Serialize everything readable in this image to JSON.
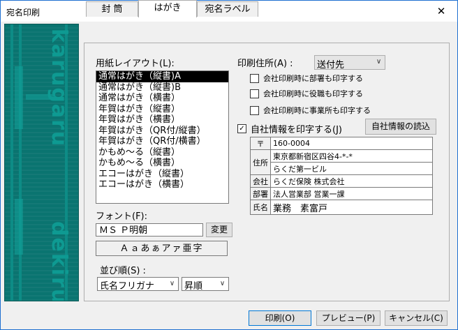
{
  "window": {
    "title": "宛名印刷",
    "close_glyph": "✕"
  },
  "banner": {
    "word1": "karugaru",
    "word2": "dekiru"
  },
  "tabs": [
    {
      "label": "封 筒"
    },
    {
      "label": "はがき"
    },
    {
      "label": "宛名ラベル"
    }
  ],
  "layout": {
    "label": "用紙レイアウト(L):",
    "items": [
      "通常はがき（縦書)A",
      "通常はがき（縦書)B",
      "通常はがき（横書）",
      "年賀はがき（縦書）",
      "年賀はがき（横書）",
      "年賀はがき（QR付/縦書）",
      "年賀はがき（QR付/横書）",
      "かもめ～る（縦書）",
      "かもめ～る（横書）",
      "エコーはがき（縦書）",
      "エコーはがき（横書）"
    ],
    "selected_index": 0
  },
  "font": {
    "label": "フォント(F):",
    "value": "ＭＳ Ｐ明朝",
    "change_button": "変更",
    "sample": "Ａａあぁアァ亜字"
  },
  "sort": {
    "label": "並び順(S) :",
    "field": "氏名フリガナ",
    "order": "昇順"
  },
  "address": {
    "label": "印刷住所(A) :",
    "value": "送付先"
  },
  "options": [
    {
      "label": "会社印刷時に部署も印字する",
      "checked": false
    },
    {
      "label": "会社印刷時に役職も印字する",
      "checked": false
    },
    {
      "label": "会社印刷時に事業所も印字する",
      "checked": false
    }
  ],
  "company": {
    "checkbox_label": "自社情報を印字する(J)",
    "checked": true,
    "load_button": "自社情報の読込",
    "postal_head": "〒",
    "postal_code": "160-0004",
    "address_head": "住所",
    "address1": "東京都新宿区四谷4-*-*",
    "address2": "らくだ第一ビル",
    "company_head": "会社",
    "company_name": "らくだ保険 株式会社",
    "dept_head": "部署",
    "dept_name": "法人営業部 営業一課",
    "name_head": "氏名",
    "person_name": "業務　素富戸"
  },
  "buttons": {
    "print": "印刷(O)",
    "preview": "プレビュー(P)",
    "cancel": "キャンセル(C)"
  }
}
